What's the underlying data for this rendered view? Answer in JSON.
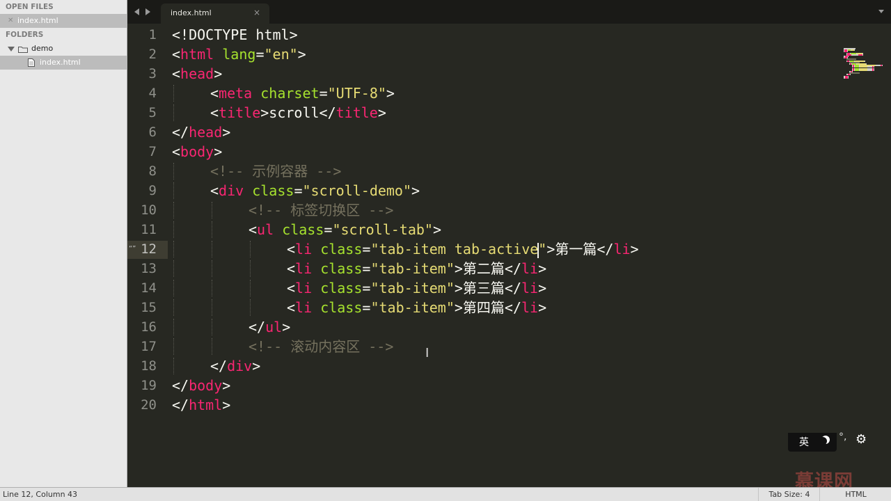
{
  "sidebar": {
    "open_files_header": "OPEN FILES",
    "open_files": [
      {
        "name": "index.html"
      }
    ],
    "folders_header": "FOLDERS",
    "folder": {
      "name": "demo"
    },
    "folder_files": [
      {
        "name": "index.html"
      }
    ]
  },
  "tabs": [
    {
      "label": "index.html",
      "close": "×"
    }
  ],
  "editor": {
    "line_numbers": [
      "1",
      "2",
      "3",
      "4",
      "5",
      "6",
      "7",
      "8",
      "9",
      "10",
      "11",
      "12",
      "13",
      "14",
      "15",
      "16",
      "17",
      "18",
      "19",
      "20"
    ],
    "active_line": 12,
    "colors": {
      "tag": "#f92672",
      "attr": "#a6e22e",
      "string": "#e6db74",
      "comment": "#75715e",
      "text": "#f8f8f2",
      "background": "#272822"
    },
    "lines": [
      {
        "indent": 0,
        "tokens": [
          {
            "t": "<!DOCTYPE html>"
          }
        ]
      },
      {
        "indent": 0,
        "tokens": [
          {
            "t": "<"
          },
          {
            "t": "html",
            "c": "tag"
          },
          {
            "t": " "
          },
          {
            "t": "lang",
            "c": "attr"
          },
          {
            "t": "="
          },
          {
            "t": "\"en\"",
            "c": "str"
          },
          {
            "t": ">"
          }
        ]
      },
      {
        "indent": 0,
        "tokens": [
          {
            "t": "<"
          },
          {
            "t": "head",
            "c": "tag"
          },
          {
            "t": ">"
          }
        ]
      },
      {
        "indent": 1,
        "tokens": [
          {
            "t": "<"
          },
          {
            "t": "meta",
            "c": "tag"
          },
          {
            "t": " "
          },
          {
            "t": "charset",
            "c": "attr"
          },
          {
            "t": "="
          },
          {
            "t": "\"UTF-8\"",
            "c": "str"
          },
          {
            "t": ">"
          }
        ]
      },
      {
        "indent": 1,
        "tokens": [
          {
            "t": "<"
          },
          {
            "t": "title",
            "c": "tag"
          },
          {
            "t": ">scroll</"
          },
          {
            "t": "title",
            "c": "tag"
          },
          {
            "t": ">"
          }
        ]
      },
      {
        "indent": 0,
        "tokens": [
          {
            "t": "</"
          },
          {
            "t": "head",
            "c": "tag"
          },
          {
            "t": ">"
          }
        ]
      },
      {
        "indent": 0,
        "tokens": [
          {
            "t": "<"
          },
          {
            "t": "body",
            "c": "tag"
          },
          {
            "t": ">"
          }
        ]
      },
      {
        "indent": 1,
        "tokens": [
          {
            "t": "<!-- 示例容器 -->",
            "c": "cmt"
          }
        ]
      },
      {
        "indent": 1,
        "tokens": [
          {
            "t": "<"
          },
          {
            "t": "div",
            "c": "tag"
          },
          {
            "t": " "
          },
          {
            "t": "class",
            "c": "attr"
          },
          {
            "t": "="
          },
          {
            "t": "\"scroll-demo\"",
            "c": "str"
          },
          {
            "t": ">"
          }
        ]
      },
      {
        "indent": 2,
        "tokens": [
          {
            "t": "<!-- 标签切换区 -->",
            "c": "cmt"
          }
        ]
      },
      {
        "indent": 2,
        "tokens": [
          {
            "t": "<"
          },
          {
            "t": "ul",
            "c": "tag"
          },
          {
            "t": " "
          },
          {
            "t": "class",
            "c": "attr"
          },
          {
            "t": "="
          },
          {
            "t": "\"scroll-tab\"",
            "c": "str"
          },
          {
            "t": ">"
          }
        ]
      },
      {
        "indent": 3,
        "tokens": [
          {
            "t": "<"
          },
          {
            "t": "li",
            "c": "tag"
          },
          {
            "t": " "
          },
          {
            "t": "class",
            "c": "attr"
          },
          {
            "t": "="
          },
          {
            "t": "\"tab-item tab-active",
            "c": "str"
          },
          {
            "caret": true
          },
          {
            "t": "\"",
            "c": "str"
          },
          {
            "t": ">第一篇</"
          },
          {
            "t": "li",
            "c": "tag"
          },
          {
            "t": ">"
          }
        ]
      },
      {
        "indent": 3,
        "tokens": [
          {
            "t": "<"
          },
          {
            "t": "li",
            "c": "tag"
          },
          {
            "t": " "
          },
          {
            "t": "class",
            "c": "attr"
          },
          {
            "t": "="
          },
          {
            "t": "\"tab-item\"",
            "c": "str"
          },
          {
            "t": ">第二篇</"
          },
          {
            "t": "li",
            "c": "tag"
          },
          {
            "t": ">"
          }
        ]
      },
      {
        "indent": 3,
        "tokens": [
          {
            "t": "<"
          },
          {
            "t": "li",
            "c": "tag"
          },
          {
            "t": " "
          },
          {
            "t": "class",
            "c": "attr"
          },
          {
            "t": "="
          },
          {
            "t": "\"tab-item\"",
            "c": "str"
          },
          {
            "t": ">第三篇</"
          },
          {
            "t": "li",
            "c": "tag"
          },
          {
            "t": ">"
          }
        ]
      },
      {
        "indent": 3,
        "tokens": [
          {
            "t": "<"
          },
          {
            "t": "li",
            "c": "tag"
          },
          {
            "t": " "
          },
          {
            "t": "class",
            "c": "attr"
          },
          {
            "t": "="
          },
          {
            "t": "\"tab-item\"",
            "c": "str"
          },
          {
            "t": ">第四篇</"
          },
          {
            "t": "li",
            "c": "tag"
          },
          {
            "t": ">"
          }
        ]
      },
      {
        "indent": 2,
        "tokens": [
          {
            "t": "</"
          },
          {
            "t": "ul",
            "c": "tag"
          },
          {
            "t": ">"
          }
        ]
      },
      {
        "indent": 2,
        "tokens": [
          {
            "t": "<!-- 滚动内容区 -->",
            "c": "cmt"
          }
        ]
      },
      {
        "indent": 1,
        "tokens": [
          {
            "t": "</"
          },
          {
            "t": "div",
            "c": "tag"
          },
          {
            "t": ">"
          }
        ]
      },
      {
        "indent": 0,
        "tokens": [
          {
            "t": "</"
          },
          {
            "t": "body",
            "c": "tag"
          },
          {
            "t": ">"
          }
        ]
      },
      {
        "indent": 0,
        "tokens": [
          {
            "t": "</"
          },
          {
            "t": "html",
            "c": "tag"
          },
          {
            "t": ">"
          }
        ]
      }
    ]
  },
  "ime_toolbar": {
    "lang": "英",
    "punct": "°,",
    "icons": [
      "moon-icon",
      "gear-icon"
    ]
  },
  "watermark": {
    "text": "慕课网"
  },
  "statusbar": {
    "position": "Line 12, Column 43",
    "tab_size": "Tab Size: 4",
    "syntax": "HTML"
  }
}
